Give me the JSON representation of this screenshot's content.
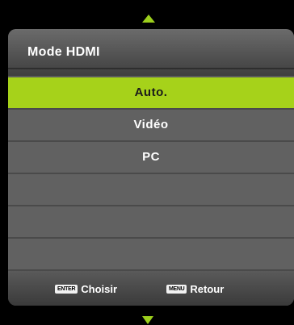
{
  "title": "Mode HDMI",
  "options": [
    {
      "label": "Auto.",
      "selected": true
    },
    {
      "label": "Vidéo",
      "selected": false
    },
    {
      "label": "PC",
      "selected": false
    },
    {
      "label": "",
      "selected": false
    },
    {
      "label": "",
      "selected": false
    },
    {
      "label": "",
      "selected": false
    }
  ],
  "footer": {
    "enter_key": "ENTER",
    "enter_label": "Choisir",
    "menu_key": "MENU",
    "menu_label": "Retour"
  },
  "colors": {
    "accent": "#a6d21a",
    "row": "#616161"
  },
  "icons": {
    "up": "scroll-up-arrow-icon",
    "down": "scroll-down-arrow-icon"
  }
}
